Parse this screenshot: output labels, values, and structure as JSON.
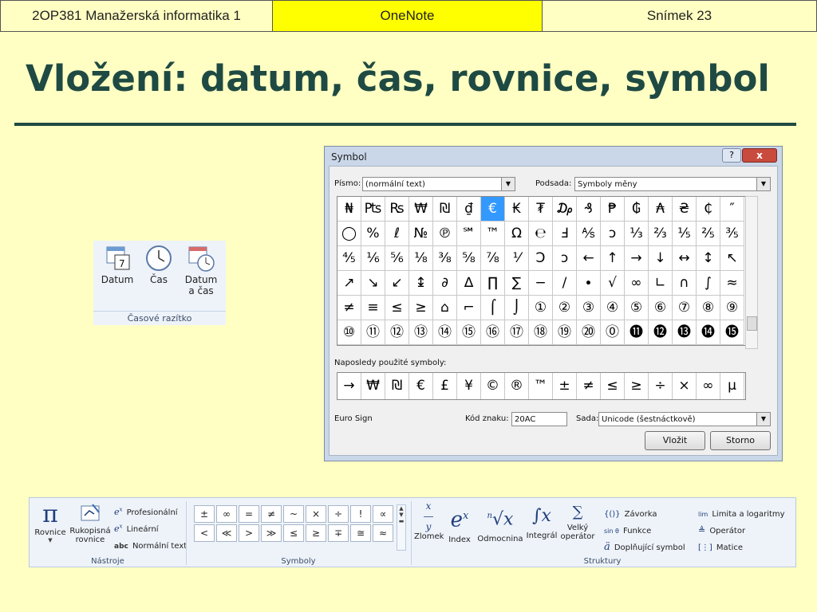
{
  "header": {
    "course": "2OP381 Manažerská informatika 1",
    "topic": "OneNote",
    "slide": "Snímek 23"
  },
  "title": "Vložení: datum, čas, rovnice, symbol",
  "timestamp": {
    "date_label": "Datum",
    "time_label": "Čas",
    "datetime_label1": "Datum",
    "datetime_label2": "a čas",
    "group_caption": "Časové razítko"
  },
  "dialog": {
    "title": "Symbol",
    "help": "?",
    "close": "x",
    "font_label": "Písmo:",
    "font_value": "(normální text)",
    "subset_label": "Podsada:",
    "subset_value": "Symboly měny",
    "symbols": [
      "₦",
      "₧",
      "₨",
      "₩",
      "₪",
      "₫",
      "€",
      "₭",
      "₮",
      "₯",
      "₰",
      "₱",
      "₲",
      "₳",
      "₴",
      "₵",
      "″",
      "◯",
      "%",
      "ℓ",
      "№",
      "℗",
      "℠",
      "™",
      "Ω",
      "℮",
      "Ⅎ",
      "⅍",
      "ↄ",
      "⅓",
      "⅔",
      "⅕",
      "⅖",
      "⅗",
      "⅘",
      "⅙",
      "⅚",
      "⅛",
      "⅜",
      "⅝",
      "⅞",
      "⅟",
      "Ↄ",
      "ↄ",
      "←",
      "↑",
      "→",
      "↓",
      "↔",
      "↕",
      "↖",
      "↗",
      "↘",
      "↙",
      "↨",
      "∂",
      "∆",
      "∏",
      "∑",
      "−",
      "∕",
      "∙",
      "√",
      "∞",
      "∟",
      "∩",
      "∫",
      "≈",
      "≠",
      "≡",
      "≤",
      "≥",
      "⌂",
      "⌐",
      "⌠",
      "⌡",
      "①",
      "②",
      "③",
      "④",
      "⑤",
      "⑥",
      "⑦",
      "⑧",
      "⑨",
      "⑩",
      "⑪",
      "⑫",
      "⑬",
      "⑭",
      "⑮",
      "⑯",
      "⑰",
      "⑱",
      "⑲",
      "⑳",
      "⓪",
      "⓫",
      "⓬",
      "⓭",
      "⓮",
      "⓯"
    ],
    "selected_index": 6,
    "recent_label": "Naposledy použité symboly:",
    "recent": [
      "→",
      "₩",
      "₪",
      "€",
      "£",
      "¥",
      "©",
      "®",
      "™",
      "±",
      "≠",
      "≤",
      "≥",
      "÷",
      "×",
      "∞",
      "µ"
    ],
    "char_name": "Euro Sign",
    "code_label": "Kód znaku:",
    "code_value": "20AC",
    "from_label": "Sada:",
    "from_value": "Unicode (šestnáctkově)",
    "insert_button": "Vložit",
    "cancel_button": "Storno"
  },
  "ribbon": {
    "tools": {
      "equation_label": "Rovnice",
      "ink_label1": "Rukopisná",
      "ink_label2": "rovnice",
      "professional": "Profesionální",
      "linear": "Lineární",
      "normal_text": "Normální text",
      "caption": "Nástroje",
      "pi": "π"
    },
    "symbols": {
      "row1": [
        "±",
        "∞",
        "=",
        "≠",
        "~",
        "×",
        "÷",
        "!",
        "∝"
      ],
      "row2": [
        "<",
        "≪",
        ">",
        "≫",
        "≤",
        "≥",
        "∓",
        "≅",
        "≈"
      ],
      "caption": "Symboly"
    },
    "structures": {
      "fraction": "Zlomek",
      "script": "Index",
      "radical": "Odmocnina",
      "integral": "Integrál",
      "large_op1": "Velký",
      "large_op2": "operátor",
      "bracket": "Závorka",
      "function": "Funkce",
      "accent": "Doplňující symbol",
      "limit": "Limita a logaritmy",
      "operator": "Operátor",
      "matrix": "Matice",
      "caption": "Struktury"
    }
  }
}
